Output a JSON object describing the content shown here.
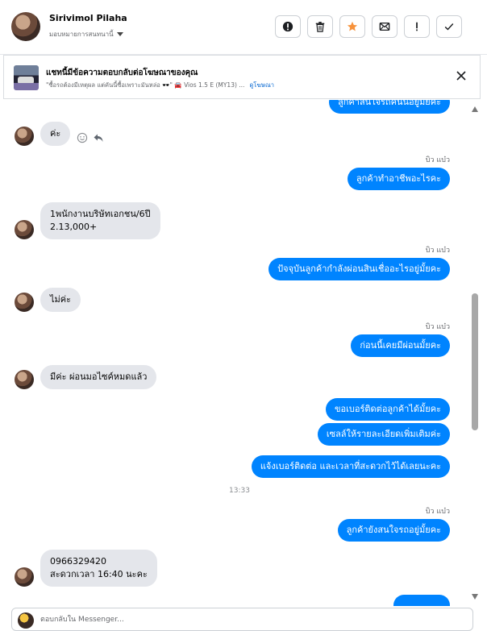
{
  "header": {
    "contact_name": "Sirivimol Pilaha",
    "assign_label": "มอบหมายการสนทนานี้",
    "toolbar": {
      "icons": [
        "alert-circle-icon",
        "trash-icon",
        "star-icon",
        "block-mail-icon",
        "exclamation-icon",
        "check-icon"
      ],
      "star_color": "#f7923b"
    }
  },
  "ad": {
    "title": "แชทนี้มีข้อความตอบกลับต่อโฆษณาของคุณ",
    "quote": "\"ซื้อรถต้องมีเหตุผล แต่คันนี้ซื้อเพราะมันหล่อ 🕶️\" 🚘 Vios 1.5 E (MY13) ...",
    "link": "ดูโฆษณา"
  },
  "messages": {
    "partial_top": "ลูกค้าสนใจรถคันนี้อยู่มั้ยคะ",
    "m1": "ค่ะ",
    "sender1": "บิว แบ๋ว",
    "m2": "ลูกค้าทำอาชีพอะไรคะ",
    "m3_line1": "1พนักงานบริษัทเอกชน/6ปี",
    "m3_line2": "2.13,000+",
    "sender2": "บิว แบ๋ว",
    "m4": "ปัจจุบันลูกค้ากำลังผ่อนสินเชื่ออะไรอยู่มั้ยคะ",
    "m5": "ไม่ค่ะ",
    "sender3": "บิว แบ๋ว",
    "m6": "ก่อนนี้เคยมีผ่อนมั้ยคะ",
    "m7": "มีค่ะ ผ่อนมอไซค์หมดแล้ว",
    "m8": "ขอเบอร์ติดต่อลูกค้าได้มั้ยคะ",
    "m9": "เซลล์ให้รายละเอียดเพิ่มเติมค่ะ",
    "m10": "แจ้งเบอร์ติดต่อ  และเวลาที่สะดวกไว้ได้เลยนะคะ",
    "time1": "13:33",
    "sender4": "บิว แบ๋ว",
    "m11": "ลูกค้ายังสนใจรถอยู่มั้ยคะ",
    "m12_line1": "0966329420",
    "m12_line2": "สะดวกเวลา 16:40 นะคะ"
  },
  "composer": {
    "placeholder": "ตอบกลับใน Messenger..."
  },
  "colors": {
    "outgoing_bubble": "#0084ff",
    "incoming_bubble": "#e4e6eb",
    "link": "#0064d1"
  }
}
